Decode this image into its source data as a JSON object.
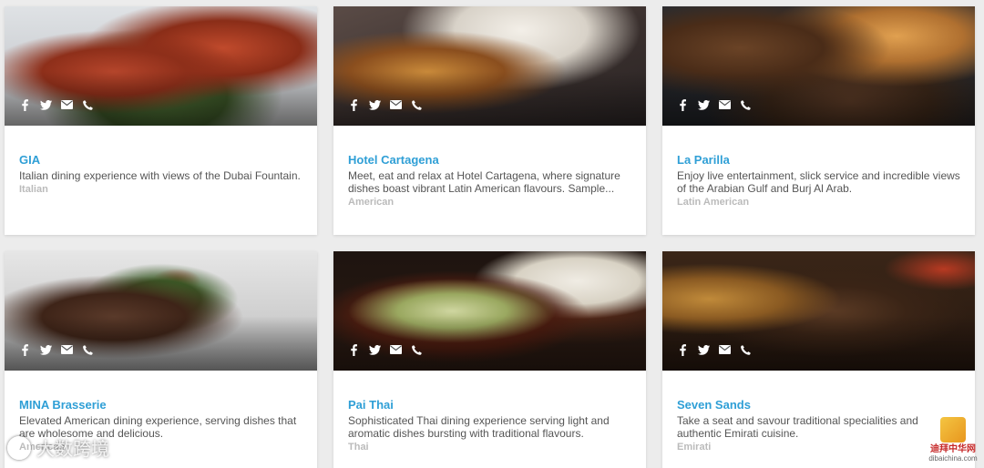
{
  "restaurants": [
    {
      "name": "GIA",
      "description": "Italian dining experience with views of the Dubai Fountain.",
      "cuisine": "Italian"
    },
    {
      "name": "Hotel Cartagena",
      "description": "Meet, eat and relax at Hotel Cartagena, where signature dishes boast vibrant Latin American flavours. Sample...",
      "cuisine": "American"
    },
    {
      "name": "La Parilla",
      "description": "Enjoy live entertainment, slick service and incredible views of the Arabian Gulf and Burj Al Arab.",
      "cuisine": "Latin American"
    },
    {
      "name": "MINA Brasserie",
      "description": "Elevated American dining experience, serving dishes that are wholesome and delicious.",
      "cuisine": "American"
    },
    {
      "name": "Pai Thai",
      "description": "Sophisticated Thai dining experience serving light and aromatic dishes bursting with traditional flavours.",
      "cuisine": "Thai"
    },
    {
      "name": "Seven Sands",
      "description": "Take a seat and savour traditional specialities and authentic Emirati cuisine.",
      "cuisine": "Emirati"
    }
  ],
  "social_icons": [
    "facebook-icon",
    "twitter-icon",
    "email-icon",
    "phone-icon"
  ],
  "watermark_left": "大数跨境",
  "watermark_right": {
    "line1": "迪拜中华网",
    "line2": "dibaichina.com"
  },
  "colors": {
    "name_link": "#2f9fd6",
    "description": "#555555",
    "cuisine": "#bbbbbb",
    "background": "#ececec"
  }
}
